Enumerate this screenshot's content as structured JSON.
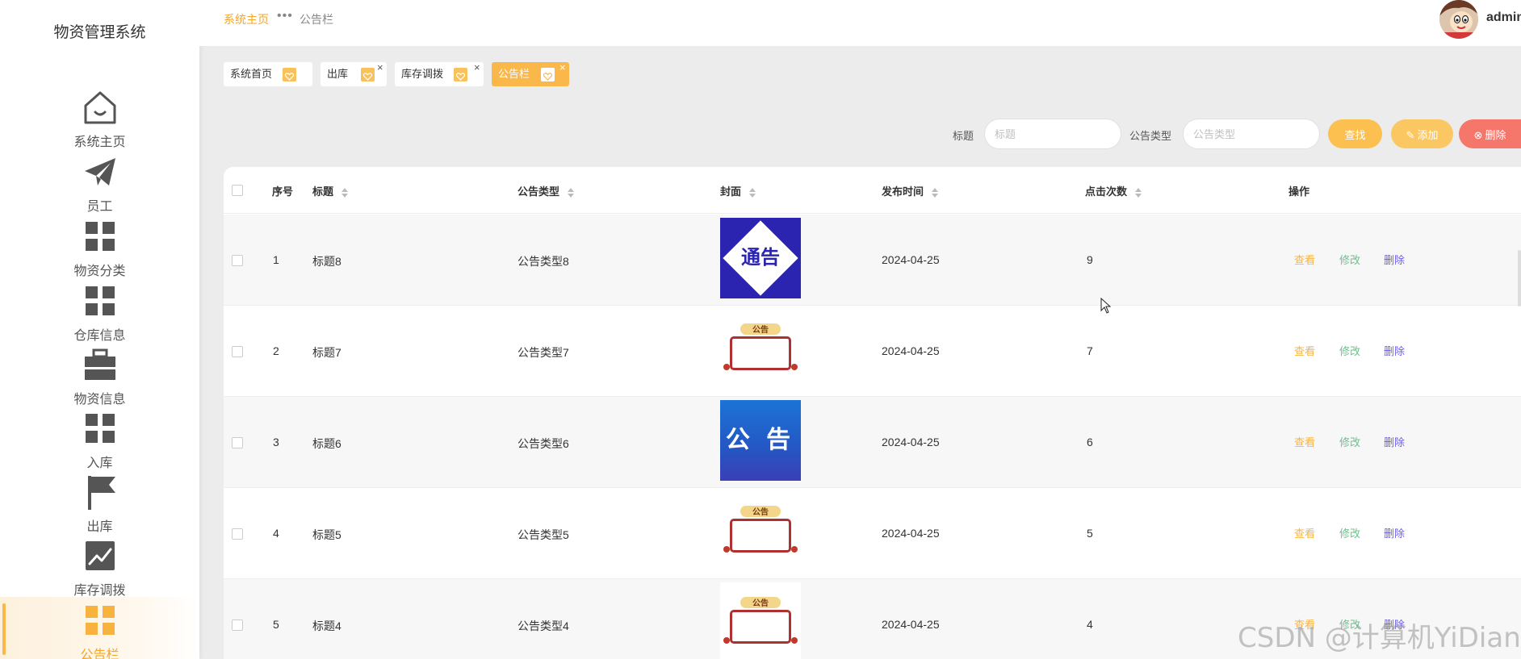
{
  "app": {
    "title": "物资管理系统"
  },
  "sidebar": {
    "items": [
      {
        "label": "系统主页",
        "icon": "home-icon",
        "active": false
      },
      {
        "label": "员工",
        "icon": "paper-plane-icon",
        "active": false
      },
      {
        "label": "物资分类",
        "icon": "grid-icon",
        "active": false
      },
      {
        "label": "仓库信息",
        "icon": "grid-icon",
        "active": false
      },
      {
        "label": "物资信息",
        "icon": "briefcase-icon",
        "active": false
      },
      {
        "label": "入库",
        "icon": "grid-icon",
        "active": false
      },
      {
        "label": "出库",
        "icon": "flag-icon",
        "active": false
      },
      {
        "label": "库存调拨",
        "icon": "trend-chart-icon",
        "active": false
      },
      {
        "label": "公告栏",
        "icon": "grid-icon",
        "active": true
      }
    ]
  },
  "header": {
    "breadcrumb_home": "系统主页",
    "breadcrumb_separator": "•••",
    "breadcrumb_current": "公告栏",
    "username": "admin"
  },
  "tabs": [
    {
      "label": "系统首页",
      "closable": false,
      "active": false
    },
    {
      "label": "出库",
      "closable": true,
      "active": false
    },
    {
      "label": "库存调拨",
      "closable": true,
      "active": false
    },
    {
      "label": "公告栏",
      "closable": true,
      "active": true
    }
  ],
  "tab_close_glyph": "×",
  "search": {
    "title_label": "标题",
    "title_placeholder": "标题",
    "type_label": "公告类型",
    "type_placeholder": "公告类型",
    "find_label": "查找",
    "add_label": "添加",
    "delete_label": "删除"
  },
  "table": {
    "columns": [
      "序号",
      "标题",
      "公告类型",
      "封面",
      "发布时间",
      "点击次数",
      "操作"
    ],
    "action_labels": {
      "view": "查看",
      "edit": "修改",
      "delete": "删除"
    },
    "rows": [
      {
        "index": "1",
        "title": "标题8",
        "type": "公告类型8",
        "cover": "通告",
        "date": "2024-04-25",
        "clicks": "9"
      },
      {
        "index": "2",
        "title": "标题7",
        "type": "公告类型7",
        "cover": "公告",
        "date": "2024-04-25",
        "clicks": "7"
      },
      {
        "index": "3",
        "title": "标题6",
        "type": "公告类型6",
        "cover": "公 告",
        "date": "2024-04-25",
        "clicks": "6"
      },
      {
        "index": "4",
        "title": "标题5",
        "type": "公告类型5",
        "cover": "公告",
        "date": "2024-04-25",
        "clicks": "5"
      },
      {
        "index": "5",
        "title": "标题4",
        "type": "公告类型4",
        "cover": "公告",
        "date": "2024-04-25",
        "clicks": "4"
      }
    ]
  },
  "watermark": "CSDN @计算机YiDian",
  "colors": {
    "accent": "#f5a623",
    "tab_active": "#fbb84a",
    "btn_find": "#fbc04f",
    "btn_add": "#fbc763",
    "btn_delete": "#f5766b",
    "action_view": "#f5b449",
    "action_edit": "#6cc08b",
    "action_delete": "#6b5df0"
  }
}
